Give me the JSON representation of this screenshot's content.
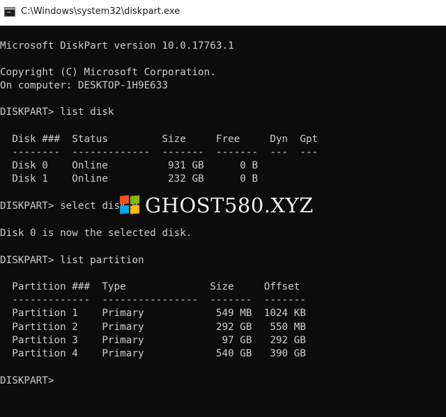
{
  "window": {
    "title": "C:\\Windows\\system32\\diskpart.exe",
    "title_icon": "console-icon"
  },
  "console": {
    "lines": [
      "",
      "Microsoft DiskPart version 10.0.17763.1",
      "",
      "Copyright (C) Microsoft Corporation.",
      "On computer: DESKTOP-1H9E633",
      "",
      "DISKPART> list disk",
      "",
      "  Disk ###  Status         Size     Free     Dyn  Gpt",
      "  --------  -------------  -------  -------  ---  ---",
      "  Disk 0    Online          931 GB      0 B",
      "  Disk 1    Online          232 GB      0 B",
      "",
      "DISKPART> select disk 0",
      "",
      "Disk 0 is now the selected disk.",
      "",
      "DISKPART> list partition",
      "",
      "  Partition ###  Type              Size     Offset",
      "  -------------  ----------------  -------  -------",
      "  Partition 1    Primary            549 MB  1024 KB",
      "  Partition 2    Primary            292 GB   550 MB",
      "  Partition 3    Primary             97 GB   292 GB",
      "  Partition 4    Primary            540 GB   390 GB",
      "",
      "DISKPART> "
    ]
  },
  "watermark": {
    "text": "GHOST580.XYZ",
    "logo_icon": "windows-logo-icon"
  },
  "colors": {
    "console_bg": "#0c0c0c",
    "console_fg": "#cccccc",
    "titlebar_bg": "#ffffff"
  }
}
